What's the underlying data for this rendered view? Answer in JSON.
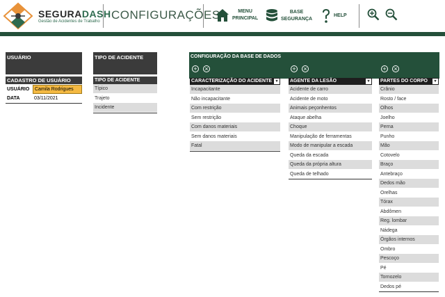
{
  "header": {
    "brand_a": "SEGURA",
    "brand_b": "DASH",
    "brand_sub": "Gestão de Acidentes de Trabalho",
    "title": "CONFIGURAÇÕES",
    "menu_label_1": "MENU",
    "menu_label_2": "PRINCIPAL",
    "base_label_1": "BASE",
    "base_label_2": "SEGURANÇA",
    "help_label": "HELP"
  },
  "usuario": {
    "section_title": "USUÁRIO",
    "cadastro_title": "CADASTRO DE USUÁRIO",
    "user_label": "USUÁRIO",
    "user_value": "Camila Rodrigues",
    "date_label": "DATA",
    "date_value": "03/11/2021"
  },
  "tipo": {
    "section_title": "TIPO DE ACIDENTE",
    "table_header": "TIPO DE ACIDENTE",
    "items": [
      "Típico",
      "Trajeto",
      "Incidente"
    ]
  },
  "config": {
    "title": "CONFIGURAÇÃO DA BASE  DE DADOS",
    "caracterizacao": {
      "header": "CARACTERIZAÇÃO DO ACIDENTE",
      "items": [
        "Incapacitante",
        "Não incapacitante",
        "Com restrição",
        "Sem restrição",
        "Com danos materiais",
        "Sem danos materiais",
        "Fatal"
      ]
    },
    "agente": {
      "header": "AGENTE DA LESÃO",
      "items": [
        "Acidente de carro",
        "Acidente de moto",
        "Animais peçonhentos",
        "Ataque abelha",
        "Choque",
        "Manipulação de ferramentas",
        "Modo de manipular a escada",
        "Queda da escada",
        "Queda da própria altura",
        "Queda de telhado"
      ]
    },
    "partes": {
      "header": "PARTES DO CORPO",
      "items": [
        "Crânio",
        "Rosto / face",
        "Olhos",
        "Joelho",
        "Perna",
        "Punho",
        "Mão",
        "Cotovelo",
        "Braço",
        "Antebraço",
        "Dedos mão",
        "Orelhas",
        "Tórax",
        "Abdômen",
        "Reg. lombar",
        "Nádega",
        "Órgãos internos",
        "Ombro",
        "Pescoço",
        "Pé",
        "Tornozelo",
        "Dedos pé"
      ]
    }
  }
}
